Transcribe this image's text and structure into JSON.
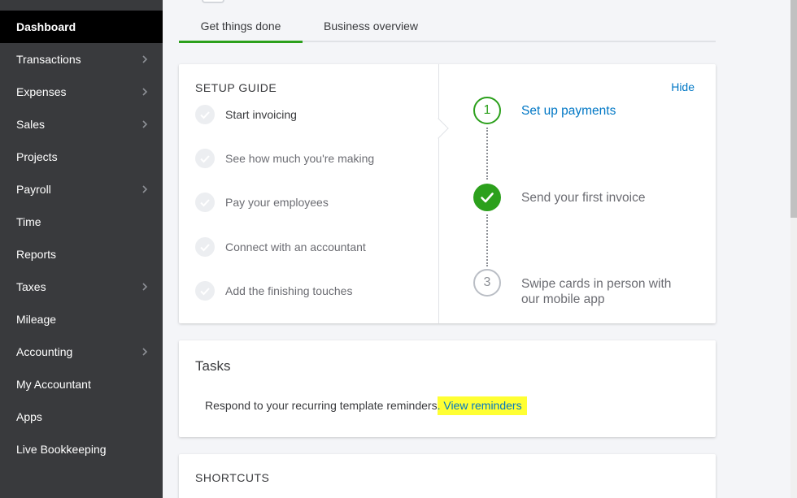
{
  "sidebar": {
    "items": [
      {
        "label": "Dashboard",
        "active": true,
        "has_submenu": false
      },
      {
        "label": "Transactions",
        "active": false,
        "has_submenu": true
      },
      {
        "label": "Expenses",
        "active": false,
        "has_submenu": true
      },
      {
        "label": "Sales",
        "active": false,
        "has_submenu": true
      },
      {
        "label": "Projects",
        "active": false,
        "has_submenu": false
      },
      {
        "label": "Payroll",
        "active": false,
        "has_submenu": true
      },
      {
        "label": "Time",
        "active": false,
        "has_submenu": false
      },
      {
        "label": "Reports",
        "active": false,
        "has_submenu": false
      },
      {
        "label": "Taxes",
        "active": false,
        "has_submenu": true
      },
      {
        "label": "Mileage",
        "active": false,
        "has_submenu": false
      },
      {
        "label": "Accounting",
        "active": false,
        "has_submenu": true
      },
      {
        "label": "My Accountant",
        "active": false,
        "has_submenu": false
      },
      {
        "label": "Apps",
        "active": false,
        "has_submenu": false
      },
      {
        "label": "Live Bookkeeping",
        "active": false,
        "has_submenu": false
      }
    ]
  },
  "tabs": [
    {
      "label": "Get things done",
      "active": true
    },
    {
      "label": "Business overview",
      "active": false
    }
  ],
  "setup_guide": {
    "title": "SETUP GUIDE",
    "hide_label": "Hide",
    "steps": [
      {
        "label": "Start invoicing",
        "current": true
      },
      {
        "label": "See how much you're making",
        "current": false
      },
      {
        "label": "Pay your employees",
        "current": false
      },
      {
        "label": "Connect with an accountant",
        "current": false
      },
      {
        "label": "Add the finishing touches",
        "current": false
      }
    ],
    "substeps": [
      {
        "number": "1",
        "label": "Set up payments",
        "state": "current"
      },
      {
        "number": "",
        "label": "Send your first invoice",
        "state": "done"
      },
      {
        "number": "3",
        "label": "Swipe cards in person with our mobile app",
        "state": "todo"
      }
    ]
  },
  "tasks": {
    "title": "Tasks",
    "message": "Respond to your recurring template reminders",
    "link_label": ". View reminders"
  },
  "shortcuts": {
    "title": "SHORTCUTS"
  },
  "colors": {
    "sidebar_bg": "#393a3d",
    "active_bg": "#000000",
    "accent_green": "#2ca01c",
    "link_blue": "#0077c5",
    "highlight_yellow": "#ffff33"
  },
  "icons": {
    "submenu": "chevron-right-icon",
    "step_check": "check-circle-icon",
    "done": "checkmark-icon"
  }
}
